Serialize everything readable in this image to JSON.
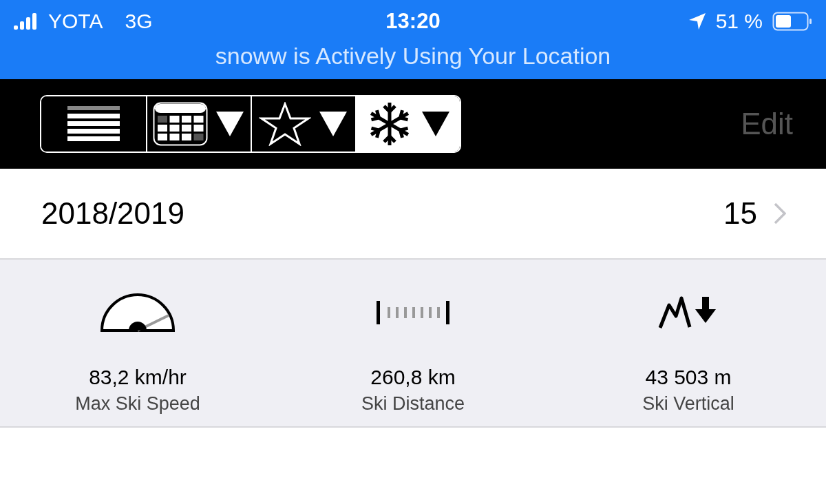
{
  "status_bar": {
    "carrier": "YOTA",
    "network": "3G",
    "time": "13:20",
    "battery": "51 %"
  },
  "location_banner": "snoww is Actively Using Your Location",
  "toolbar": {
    "segments": [
      {
        "kind": "list",
        "selected": false
      },
      {
        "kind": "calendar",
        "selected": false
      },
      {
        "kind": "star",
        "selected": false
      },
      {
        "kind": "snowflake",
        "selected": true
      }
    ],
    "edit": "Edit"
  },
  "season": {
    "label": "2018/2019",
    "count": "15"
  },
  "stats": [
    {
      "kind": "speed",
      "value": "83,2 km/hr",
      "label": "Max Ski Speed"
    },
    {
      "kind": "distance",
      "value": "260,8 km",
      "label": "Ski Distance"
    },
    {
      "kind": "vertical",
      "value": "43 503 m",
      "label": "Ski Vertical"
    }
  ]
}
